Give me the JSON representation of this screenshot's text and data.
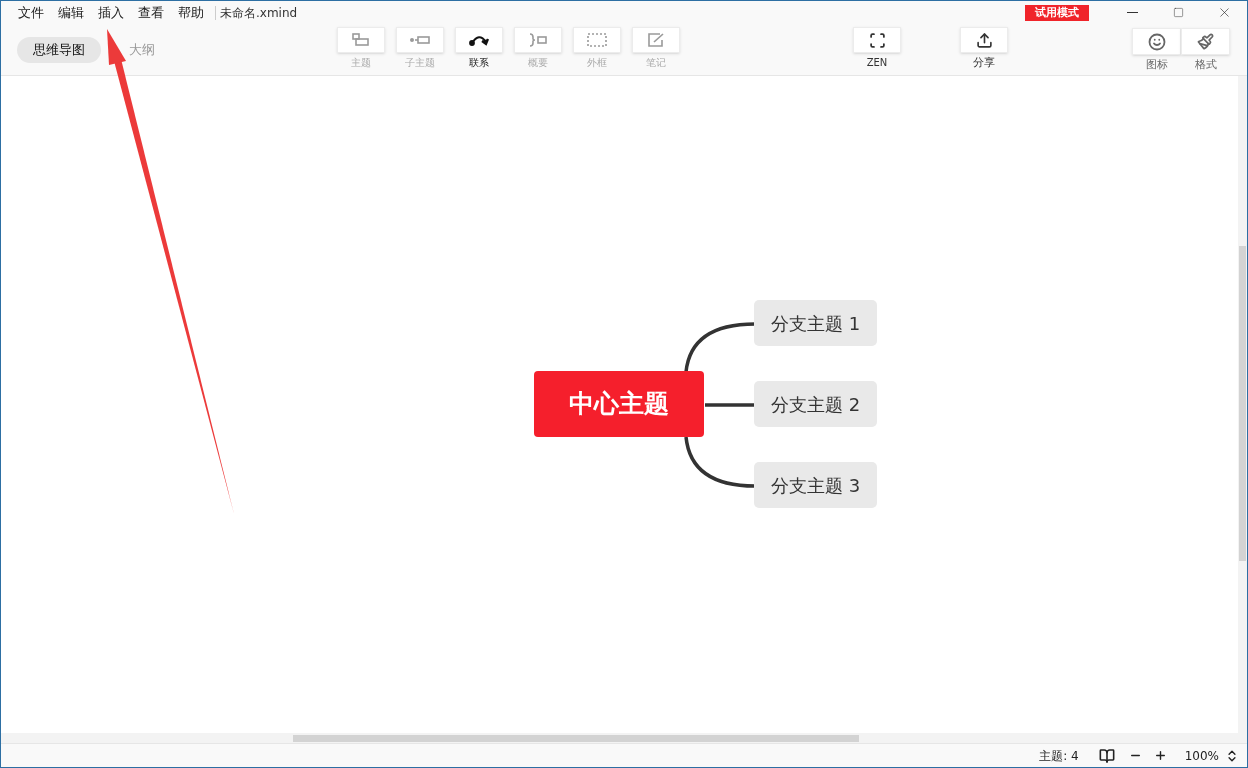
{
  "menu": [
    "文件",
    "编辑",
    "插入",
    "查看",
    "帮助"
  ],
  "document_title": "未命名.xmind",
  "trial_badge": "试用模式",
  "view_tabs": [
    {
      "label": "思维导图",
      "selected": true
    },
    {
      "label": "大纲",
      "selected": false
    }
  ],
  "toolbar": [
    {
      "kind": "topic",
      "label": "主题",
      "disabled": true
    },
    {
      "kind": "subtopic",
      "label": "子主题",
      "disabled": true
    },
    {
      "kind": "relationship",
      "label": "联系",
      "disabled": false
    },
    {
      "kind": "summary",
      "label": "概要",
      "disabled": true
    },
    {
      "kind": "boundary",
      "label": "外框",
      "disabled": true
    },
    {
      "kind": "note",
      "label": "笔记",
      "disabled": true
    }
  ],
  "zen": {
    "label": "ZEN"
  },
  "share": {
    "label": "分享"
  },
  "panel_buttons": [
    {
      "kind": "icon",
      "label": "图标"
    },
    {
      "kind": "format",
      "label": "格式"
    }
  ],
  "mind_map": {
    "central_topic": "中心主题",
    "branches": [
      "分支主题 1",
      "分支主题 2",
      "分支主题 3"
    ]
  },
  "status_bar": {
    "topic_count": "主题: 4",
    "zoom": "100%"
  }
}
